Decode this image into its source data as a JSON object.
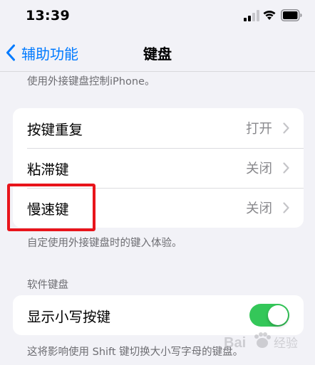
{
  "status_bar": {
    "time": "13:39"
  },
  "nav": {
    "back_label": "辅助功能",
    "title": "键盘"
  },
  "top_caption": "使用外接键盘控制iPhone。",
  "hardware_group": {
    "rows": [
      {
        "label": "按键重复",
        "value": "打开"
      },
      {
        "label": "粘滞键",
        "value": "关闭"
      },
      {
        "label": "慢速键",
        "value": "关闭"
      }
    ],
    "footer": "自定使用外接键盘时的键入体验。"
  },
  "software_group": {
    "header": "软件键盘",
    "rows": [
      {
        "label": "显示小写按键",
        "toggle_on": true
      }
    ],
    "footer": "这将影响使用 Shift 键切换大小写字母的键盘。"
  },
  "icons": {
    "back": "chevron-left-icon",
    "row_chevron": "chevron-right-icon",
    "signal": "cellular-signal-icon",
    "wifi": "wifi-icon",
    "battery": "battery-icon"
  },
  "colors": {
    "accent": "#007aff",
    "toggle_on": "#34c759",
    "highlight": "#e8141b",
    "background": "#f2f2f7",
    "secondary_text": "#8a8a8e"
  },
  "watermark": {
    "text": "Bai 经验"
  }
}
